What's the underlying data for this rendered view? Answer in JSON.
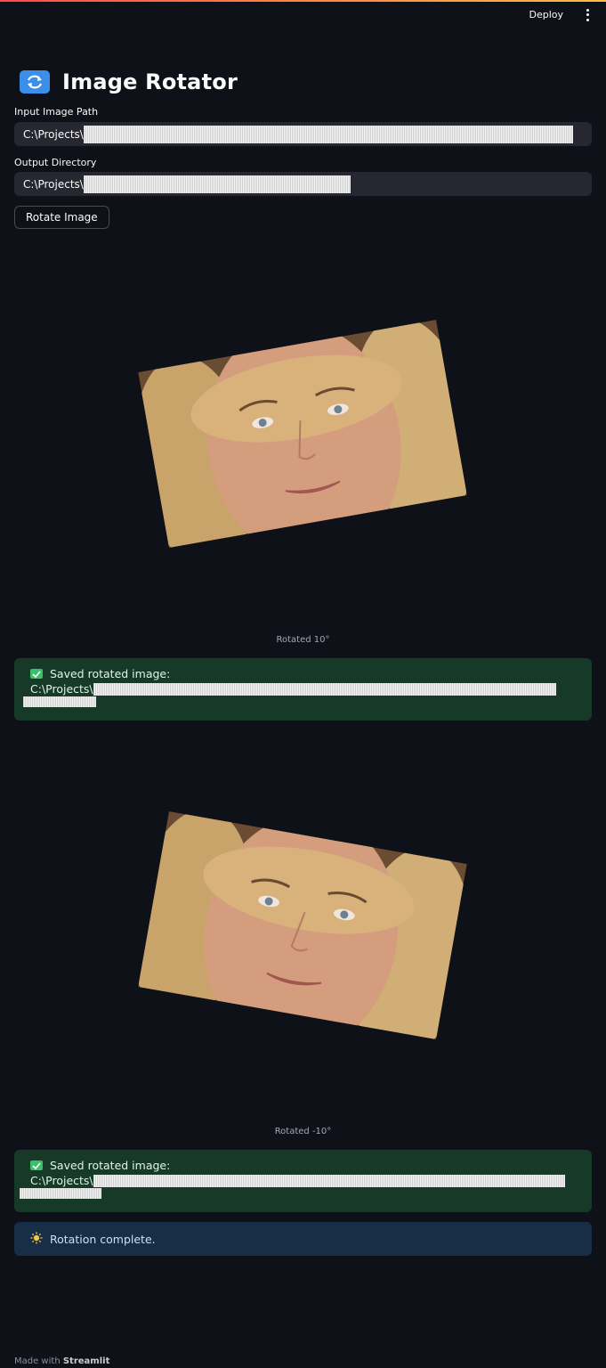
{
  "header": {
    "deploy_label": "Deploy"
  },
  "title": {
    "icon": "repeat-arrows-icon",
    "text": "Image Rotator"
  },
  "input_path": {
    "label": "Input Image Path",
    "value": "C:\\Projects\\"
  },
  "output_dir": {
    "label": "Output Directory",
    "value": "C:\\Projects\\"
  },
  "rotate_button": "Rotate Image",
  "results": [
    {
      "caption": "Rotated 10°",
      "message": "Saved rotated image:",
      "path": "C:\\Projects\\",
      "rotation": 10
    },
    {
      "caption": "Rotated -10°",
      "message": "Saved rotated image:",
      "path": "C:\\Projects\\",
      "rotation": -10
    }
  ],
  "info": {
    "icon": "sun-icon",
    "text": "Rotation complete."
  },
  "footer": {
    "prefix": "Made with",
    "brand": "Streamlit"
  },
  "colors": {
    "background": "#0e1117",
    "input_bg": "#262730",
    "success_bg": "#173928",
    "info_bg": "#172d48",
    "accent": "#ff4b4b"
  }
}
